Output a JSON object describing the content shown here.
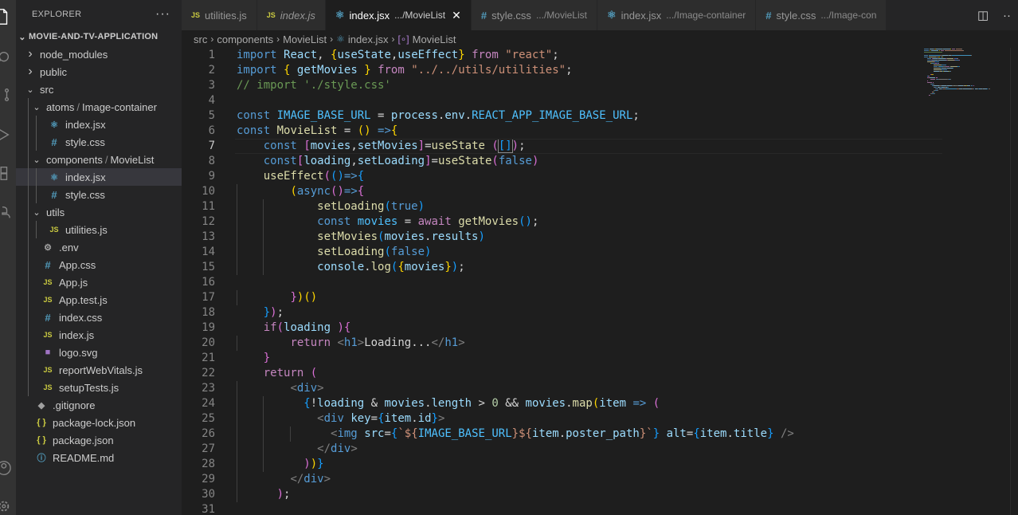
{
  "explorer": {
    "title": "EXPLORER",
    "more": "···",
    "project": "MOVIE-AND-TV-APPLICATION",
    "tree": [
      {
        "label": "node_modules",
        "type": "folder",
        "open": false,
        "depth": 1
      },
      {
        "label": "public",
        "type": "folder",
        "open": false,
        "depth": 1
      },
      {
        "label": "src",
        "type": "folder",
        "open": true,
        "depth": 1
      },
      {
        "label": "atoms",
        "label2": "Image-container",
        "type": "folder",
        "open": true,
        "depth": 2
      },
      {
        "label": "index.jsx",
        "type": "react",
        "depth": 3
      },
      {
        "label": "style.css",
        "type": "css",
        "depth": 3
      },
      {
        "label": "components",
        "label2": "MovieList",
        "type": "folder",
        "open": true,
        "depth": 2
      },
      {
        "label": "index.jsx",
        "type": "react",
        "depth": 3,
        "selected": true
      },
      {
        "label": "style.css",
        "type": "css",
        "depth": 3
      },
      {
        "label": "utils",
        "type": "folder",
        "open": true,
        "depth": 2
      },
      {
        "label": "utilities.js",
        "type": "js",
        "depth": 3
      },
      {
        "label": ".env",
        "type": "gear",
        "depth": 2
      },
      {
        "label": "App.css",
        "type": "css",
        "depth": 2
      },
      {
        "label": "App.js",
        "type": "js",
        "depth": 2
      },
      {
        "label": "App.test.js",
        "type": "jstest",
        "depth": 2
      },
      {
        "label": "index.css",
        "type": "css",
        "depth": 2
      },
      {
        "label": "index.js",
        "type": "js",
        "depth": 2
      },
      {
        "label": "logo.svg",
        "type": "svg",
        "depth": 2
      },
      {
        "label": "reportWebVitals.js",
        "type": "js",
        "depth": 2
      },
      {
        "label": "setupTests.js",
        "type": "js",
        "depth": 2
      },
      {
        "label": ".gitignore",
        "type": "git",
        "depth": 1
      },
      {
        "label": "package-lock.json",
        "type": "json",
        "depth": 1
      },
      {
        "label": "package.json",
        "type": "json",
        "depth": 1
      },
      {
        "label": "README.md",
        "type": "info",
        "depth": 1
      }
    ]
  },
  "tabs": [
    {
      "label": "utilities.js",
      "icon": "JS",
      "path": "",
      "active": false,
      "italic": false
    },
    {
      "label": "index.js",
      "icon": "JS",
      "path": "",
      "active": false,
      "italic": true
    },
    {
      "label": "index.jsx",
      "icon": "react",
      "path": ".../MovieList",
      "active": true,
      "italic": false
    },
    {
      "label": "style.css",
      "icon": "#",
      "path": ".../MovieList",
      "active": false,
      "italic": false
    },
    {
      "label": "index.jsx",
      "icon": "react",
      "path": ".../Image-container",
      "active": false,
      "italic": false
    },
    {
      "label": "style.css",
      "icon": "#",
      "path": ".../Image-con",
      "active": false,
      "italic": false
    }
  ],
  "breadcrumbs": [
    "src",
    "components",
    "MovieList",
    "index.jsx",
    "MovieList"
  ],
  "editor": {
    "current_line": 7,
    "lines": [
      [
        [
          "kw",
          "import"
        ],
        [
          "txt",
          " "
        ],
        [
          "var",
          "React"
        ],
        [
          "txt",
          ", "
        ],
        [
          "b1",
          "{"
        ],
        [
          "var",
          "useState"
        ],
        [
          "txt",
          ","
        ],
        [
          "var",
          "useEffect"
        ],
        [
          "b1",
          "}"
        ],
        [
          "txt",
          " "
        ],
        [
          "ctl",
          "from"
        ],
        [
          "txt",
          " "
        ],
        [
          "str",
          "\"react\""
        ],
        [
          "txt",
          ";"
        ]
      ],
      [
        [
          "kw",
          "import"
        ],
        [
          "txt",
          " "
        ],
        [
          "b1",
          "{"
        ],
        [
          "txt",
          " "
        ],
        [
          "var",
          "getMovies"
        ],
        [
          "txt",
          " "
        ],
        [
          "b1",
          "}"
        ],
        [
          "txt",
          " "
        ],
        [
          "ctl",
          "from"
        ],
        [
          "txt",
          " "
        ],
        [
          "str",
          "\"../../utils/utilities\""
        ],
        [
          "txt",
          ";"
        ]
      ],
      [
        [
          "cmt",
          "// import './style.css'"
        ]
      ],
      [],
      [
        [
          "kw",
          "const"
        ],
        [
          "txt",
          " "
        ],
        [
          "const",
          "IMAGE_BASE_URL"
        ],
        [
          "txt",
          " = "
        ],
        [
          "var",
          "process"
        ],
        [
          "txt",
          "."
        ],
        [
          "var",
          "env"
        ],
        [
          "txt",
          "."
        ],
        [
          "const",
          "REACT_APP_IMAGE_BASE_URL"
        ],
        [
          "txt",
          ";"
        ]
      ],
      [
        [
          "kw",
          "const"
        ],
        [
          "txt",
          " "
        ],
        [
          "fn",
          "MovieList"
        ],
        [
          "txt",
          " = "
        ],
        [
          "b1",
          "()"
        ],
        [
          "txt",
          " "
        ],
        [
          "kw",
          "=>"
        ],
        [
          "b1",
          "{"
        ]
      ],
      [
        [
          "txt",
          "    "
        ],
        [
          "kw",
          "const"
        ],
        [
          "txt",
          " "
        ],
        [
          "b2",
          "["
        ],
        [
          "var",
          "movies"
        ],
        [
          "txt",
          ","
        ],
        [
          "var",
          "setMovies"
        ],
        [
          "b2",
          "]"
        ],
        [
          "txt",
          "="
        ],
        [
          "fn",
          "useState"
        ],
        [
          "txt",
          " "
        ],
        [
          "b2",
          "("
        ],
        [
          "b3",
          "[]"
        ],
        [
          "b2",
          ")"
        ],
        [
          "txt",
          ";"
        ]
      ],
      [
        [
          "txt",
          "    "
        ],
        [
          "kw",
          "const"
        ],
        [
          "b2",
          "["
        ],
        [
          "var",
          "loading"
        ],
        [
          "txt",
          ","
        ],
        [
          "var",
          "setLoading"
        ],
        [
          "b2",
          "]"
        ],
        [
          "txt",
          "="
        ],
        [
          "fn",
          "useState"
        ],
        [
          "b2",
          "("
        ],
        [
          "kw",
          "false"
        ],
        [
          "b2",
          ")"
        ]
      ],
      [
        [
          "txt",
          "    "
        ],
        [
          "fn",
          "useEffect"
        ],
        [
          "b2",
          "("
        ],
        [
          "b3",
          "()"
        ],
        [
          "kw",
          "=>"
        ],
        [
          "b3",
          "{"
        ]
      ],
      [
        [
          "txt",
          "        "
        ],
        [
          "b1",
          "("
        ],
        [
          "kw",
          "async"
        ],
        [
          "b2",
          "()"
        ],
        [
          "kw",
          "=>"
        ],
        [
          "b2",
          "{"
        ]
      ],
      [
        [
          "txt",
          "            "
        ],
        [
          "fn",
          "setLoading"
        ],
        [
          "b3",
          "("
        ],
        [
          "kw",
          "true"
        ],
        [
          "b3",
          ")"
        ]
      ],
      [
        [
          "txt",
          "            "
        ],
        [
          "kw",
          "const"
        ],
        [
          "txt",
          " "
        ],
        [
          "const",
          "movies"
        ],
        [
          "txt",
          " = "
        ],
        [
          "ctl",
          "await"
        ],
        [
          "txt",
          " "
        ],
        [
          "fn",
          "getMovies"
        ],
        [
          "b3",
          "()"
        ],
        [
          "txt",
          ";"
        ]
      ],
      [
        [
          "txt",
          "            "
        ],
        [
          "fn",
          "setMovies"
        ],
        [
          "b3",
          "("
        ],
        [
          "var",
          "movies"
        ],
        [
          "txt",
          "."
        ],
        [
          "var",
          "results"
        ],
        [
          "b3",
          ")"
        ]
      ],
      [
        [
          "txt",
          "            "
        ],
        [
          "fn",
          "setLoading"
        ],
        [
          "b3",
          "("
        ],
        [
          "kw",
          "false"
        ],
        [
          "b3",
          ")"
        ]
      ],
      [
        [
          "txt",
          "            "
        ],
        [
          "var",
          "console"
        ],
        [
          "txt",
          "."
        ],
        [
          "fn",
          "log"
        ],
        [
          "b3",
          "("
        ],
        [
          "b1",
          "{"
        ],
        [
          "var",
          "movies"
        ],
        [
          "b1",
          "}"
        ],
        [
          "b3",
          ")"
        ],
        [
          "txt",
          ";"
        ]
      ],
      [],
      [
        [
          "txt",
          "        "
        ],
        [
          "b2",
          "}"
        ],
        [
          "b1",
          ")"
        ],
        [
          "b1",
          "()"
        ]
      ],
      [
        [
          "txt",
          "    "
        ],
        [
          "b3",
          "}"
        ],
        [
          "b2",
          ")"
        ],
        [
          "txt",
          ";"
        ]
      ],
      [
        [
          "txt",
          "    "
        ],
        [
          "ctl",
          "if"
        ],
        [
          "b2",
          "("
        ],
        [
          "var",
          "loading"
        ],
        [
          "txt",
          " "
        ],
        [
          "b2",
          ")"
        ],
        [
          "b2",
          "{"
        ]
      ],
      [
        [
          "txt",
          "        "
        ],
        [
          "ctl",
          "return"
        ],
        [
          "txt",
          " "
        ],
        [
          "tag",
          "<"
        ],
        [
          "tagn",
          "h1"
        ],
        [
          "tag",
          ">"
        ],
        [
          "txt",
          "Loading..."
        ],
        [
          "tag",
          "</"
        ],
        [
          "tagn",
          "h1"
        ],
        [
          "tag",
          ">"
        ]
      ],
      [
        [
          "txt",
          "    "
        ],
        [
          "b2",
          "}"
        ]
      ],
      [
        [
          "txt",
          "    "
        ],
        [
          "ctl",
          "return"
        ],
        [
          "txt",
          " "
        ],
        [
          "b2",
          "("
        ]
      ],
      [
        [
          "txt",
          "        "
        ],
        [
          "tag",
          "<"
        ],
        [
          "tagn",
          "div"
        ],
        [
          "tag",
          ">"
        ]
      ],
      [
        [
          "txt",
          "          "
        ],
        [
          "b3",
          "{"
        ],
        [
          "txt",
          "!"
        ],
        [
          "var",
          "loading"
        ],
        [
          "txt",
          " & "
        ],
        [
          "var",
          "movies"
        ],
        [
          "txt",
          "."
        ],
        [
          "var",
          "length"
        ],
        [
          "txt",
          " > "
        ],
        [
          "num",
          "0"
        ],
        [
          "txt",
          " && "
        ],
        [
          "var",
          "movies"
        ],
        [
          "txt",
          "."
        ],
        [
          "fn",
          "map"
        ],
        [
          "b1",
          "("
        ],
        [
          "var",
          "item"
        ],
        [
          "txt",
          " "
        ],
        [
          "kw",
          "=>"
        ],
        [
          "txt",
          " "
        ],
        [
          "b2",
          "("
        ]
      ],
      [
        [
          "txt",
          "            "
        ],
        [
          "tag",
          "<"
        ],
        [
          "tagn",
          "div"
        ],
        [
          "txt",
          " "
        ],
        [
          "attr",
          "key"
        ],
        [
          "txt",
          "="
        ],
        [
          "b3",
          "{"
        ],
        [
          "var",
          "item"
        ],
        [
          "txt",
          "."
        ],
        [
          "var",
          "id"
        ],
        [
          "b3",
          "}"
        ],
        [
          "tag",
          ">"
        ]
      ],
      [
        [
          "txt",
          "              "
        ],
        [
          "tag",
          "<"
        ],
        [
          "tagn",
          "img"
        ],
        [
          "txt",
          " "
        ],
        [
          "attr",
          "src"
        ],
        [
          "txt",
          "="
        ],
        [
          "b3",
          "{"
        ],
        [
          "str",
          "`${"
        ],
        [
          "const",
          "IMAGE_BASE_URL"
        ],
        [
          "str",
          "}${"
        ],
        [
          "var",
          "item"
        ],
        [
          "txt",
          "."
        ],
        [
          "var",
          "poster_path"
        ],
        [
          "str",
          "}`"
        ],
        [
          "b3",
          "}"
        ],
        [
          "txt",
          " "
        ],
        [
          "attr",
          "alt"
        ],
        [
          "txt",
          "="
        ],
        [
          "b3",
          "{"
        ],
        [
          "var",
          "item"
        ],
        [
          "txt",
          "."
        ],
        [
          "var",
          "title"
        ],
        [
          "b3",
          "}"
        ],
        [
          "txt",
          " "
        ],
        [
          "tag",
          "/>"
        ]
      ],
      [
        [
          "txt",
          "            "
        ],
        [
          "tag",
          "</"
        ],
        [
          "tagn",
          "div"
        ],
        [
          "tag",
          ">"
        ]
      ],
      [
        [
          "txt",
          "          "
        ],
        [
          "b2",
          ")"
        ],
        [
          "b1",
          ")"
        ],
        [
          "b3",
          "}"
        ]
      ],
      [
        [
          "txt",
          "        "
        ],
        [
          "tag",
          "</"
        ],
        [
          "tagn",
          "div"
        ],
        [
          "tag",
          ">"
        ]
      ],
      [
        [
          "txt",
          "      "
        ],
        [
          "b2",
          ")"
        ],
        [
          "txt",
          ";"
        ]
      ],
      []
    ]
  },
  "colors": {
    "accent_selected": "#37373d",
    "keyword": "#569cd6",
    "string": "#ce9178"
  }
}
